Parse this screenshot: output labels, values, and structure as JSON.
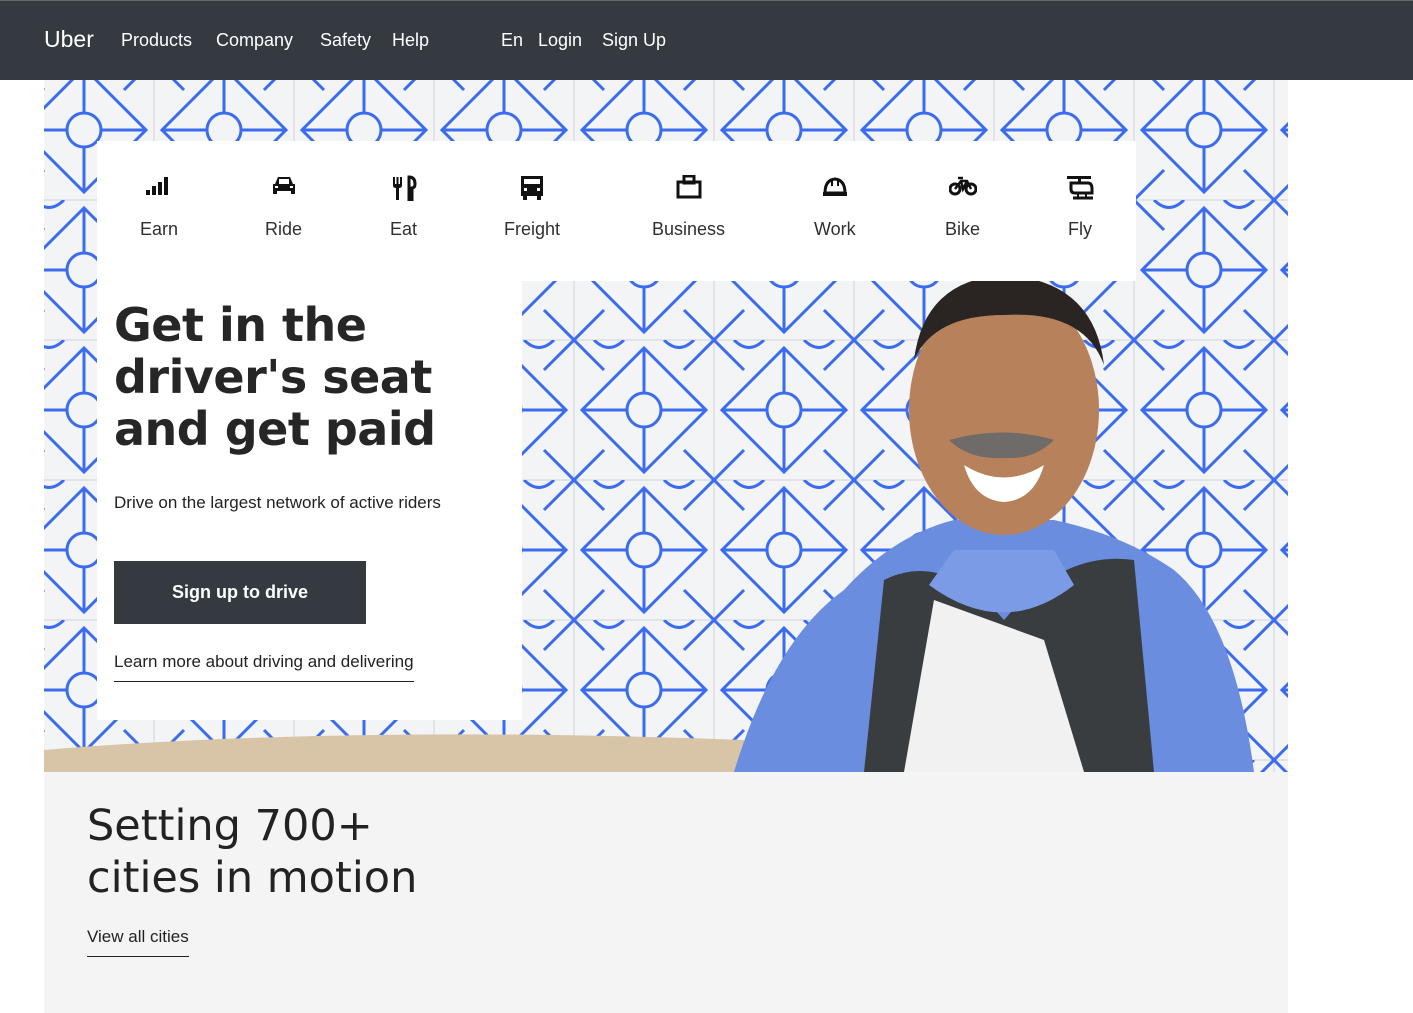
{
  "nav": {
    "brand": "Uber",
    "items": [
      "Products",
      "Company",
      "Safety",
      "Help"
    ],
    "lang": "En",
    "login": "Login",
    "signup": "Sign Up"
  },
  "tabs": [
    {
      "label": "Earn",
      "icon": "earn-bars-icon"
    },
    {
      "label": "Ride",
      "icon": "car-icon"
    },
    {
      "label": "Eat",
      "icon": "fork-knife-icon"
    },
    {
      "label": "Freight",
      "icon": "truck-icon"
    },
    {
      "label": "Business",
      "icon": "briefcase-icon"
    },
    {
      "label": "Work",
      "icon": "hard-hat-icon"
    },
    {
      "label": "Bike",
      "icon": "bike-icon"
    },
    {
      "label": "Fly",
      "icon": "helicopter-icon"
    }
  ],
  "hero": {
    "headline": "Get in the driver's seat and get paid",
    "subtext": "Drive on the largest network of active riders",
    "cta": "Sign up to drive",
    "learn_more": "Learn more about driving and delivering"
  },
  "cities": {
    "line1": "Setting 700+",
    "line2": "cities in motion",
    "link": "View all cities"
  },
  "colors": {
    "nav_bg": "#353a40",
    "pattern_blue": "#3b6cf0",
    "button_bg": "#353a40",
    "cities_bg": "#f4f4f4"
  }
}
